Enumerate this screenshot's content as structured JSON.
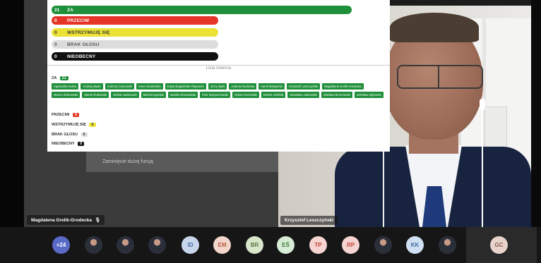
{
  "vote": {
    "rows": [
      {
        "count": "21",
        "label": "ZA"
      },
      {
        "count": "0",
        "label": "PRZECIW"
      },
      {
        "count": "0",
        "label": "WSTRZYMUJĘ SIĘ"
      },
      {
        "count": "0",
        "label": "BRAK GŁOSU"
      },
      {
        "count": "0",
        "label": "NIEOBECNY"
      }
    ],
    "list_title": "Lista imienna",
    "sections": {
      "za": {
        "label": "ZA",
        "count": "21"
      },
      "przeciw": {
        "label": "PRZECIW",
        "count": "0"
      },
      "wstrzymuje": {
        "label": "WSTRZYMUJĘ SIĘ",
        "count": "0"
      },
      "brak": {
        "label": "BRAK GŁOSU",
        "count": "0"
      },
      "nieobecny": {
        "label": "NIEOBECNY",
        "count": "0"
      }
    },
    "za_names": [
      "Agnieszka Kulma",
      "Andrzej Bętor",
      "Andrzej Czyżewski",
      "Anna Smoleńska",
      "Edyta Bogdańska-Filipowicz",
      "Jerzy Byrki",
      "Joanna Kluzkowa",
      "Kamil Matejanko",
      "Krzysztof Leszczyński",
      "Magdalena Grelik-Grodecka",
      "Marcin Żelazowski",
      "Marek Rutkowski",
      "Michał Jackiewski",
      "Michał Kopeliak",
      "Monika Śmiesakiak",
      "Piotr Wojciechowski",
      "Robert Kochalski",
      "Robert Umiński",
      "Stanisław Jankowski",
      "Wiesław Brzozowski",
      "Zdzisław Sijirowski"
    ]
  },
  "left_tile": {
    "dim_text": "Zaminięcie dużej furcją"
  },
  "speakers": {
    "left_name": "Magdalena Grelik-Grodecka",
    "right_name": "Krzysztof Leszczyński"
  },
  "participants": {
    "more_label": "+24",
    "initials": [
      "ID",
      "EM",
      "BR",
      "EŚ",
      "TP",
      "RP",
      "KK",
      "GC"
    ]
  },
  "colors": {
    "za": "#1f8f3a",
    "przeciw": "#e53428",
    "wstrzymuje": "#ece236",
    "brak": "#dcdcdc",
    "nieobecny": "#111111"
  }
}
